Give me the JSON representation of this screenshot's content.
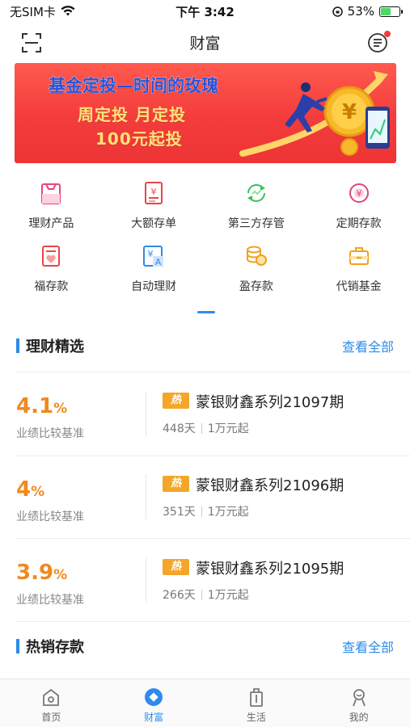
{
  "status_bar": {
    "carrier": "无SIM卡",
    "time": "下午 3:42",
    "battery": "53%"
  },
  "nav": {
    "title": "财富",
    "scan_icon": "scan-icon",
    "message_icon": "message-icon"
  },
  "banner": {
    "line1_a": "基金定投",
    "line1_b": "—时间的玫瑰",
    "line2": "周定投 月定投",
    "line3": "100元起投"
  },
  "menu": {
    "items": [
      {
        "label": "理财产品",
        "icon": "bag-icon"
      },
      {
        "label": "大额存单",
        "icon": "yuan-document-icon"
      },
      {
        "label": "第三方存管",
        "icon": "exchange-circle-icon"
      },
      {
        "label": "定期存款",
        "icon": "yuan-circle-icon"
      },
      {
        "label": "福存款",
        "icon": "heart-card-icon"
      },
      {
        "label": "自动理财",
        "icon": "auto-finance-icon"
      },
      {
        "label": "盈存款",
        "icon": "coins-icon"
      },
      {
        "label": "代销基金",
        "icon": "briefcase-icon"
      }
    ]
  },
  "section_wealth": {
    "title": "理财精选",
    "see_all": "查看全部"
  },
  "products": [
    {
      "rate": "4.1",
      "unit": "%",
      "rate_label": "业绩比较基准",
      "badge": "热",
      "name": "蒙银财鑫系列21097期",
      "days": "448天",
      "min": "1万元起"
    },
    {
      "rate": "4",
      "unit": "%",
      "rate_label": "业绩比较基准",
      "badge": "热",
      "name": "蒙银财鑫系列21096期",
      "days": "351天",
      "min": "1万元起"
    },
    {
      "rate": "3.9",
      "unit": "%",
      "rate_label": "业绩比较基准",
      "badge": "热",
      "name": "蒙银财鑫系列21095期",
      "days": "266天",
      "min": "1万元起"
    }
  ],
  "section_deposit": {
    "title": "热销存款",
    "see_all": "查看全部"
  },
  "tabs": [
    {
      "label": "首页",
      "icon": "home-icon",
      "active": false
    },
    {
      "label": "财富",
      "icon": "wealth-icon",
      "active": true
    },
    {
      "label": "生活",
      "icon": "life-icon",
      "active": false
    },
    {
      "label": "我的",
      "icon": "profile-icon",
      "active": false
    }
  ],
  "colors": {
    "accent": "#2e8bea",
    "rate": "#f08a1e",
    "badge": "#f4a62a",
    "banner": "#f33c3c"
  }
}
